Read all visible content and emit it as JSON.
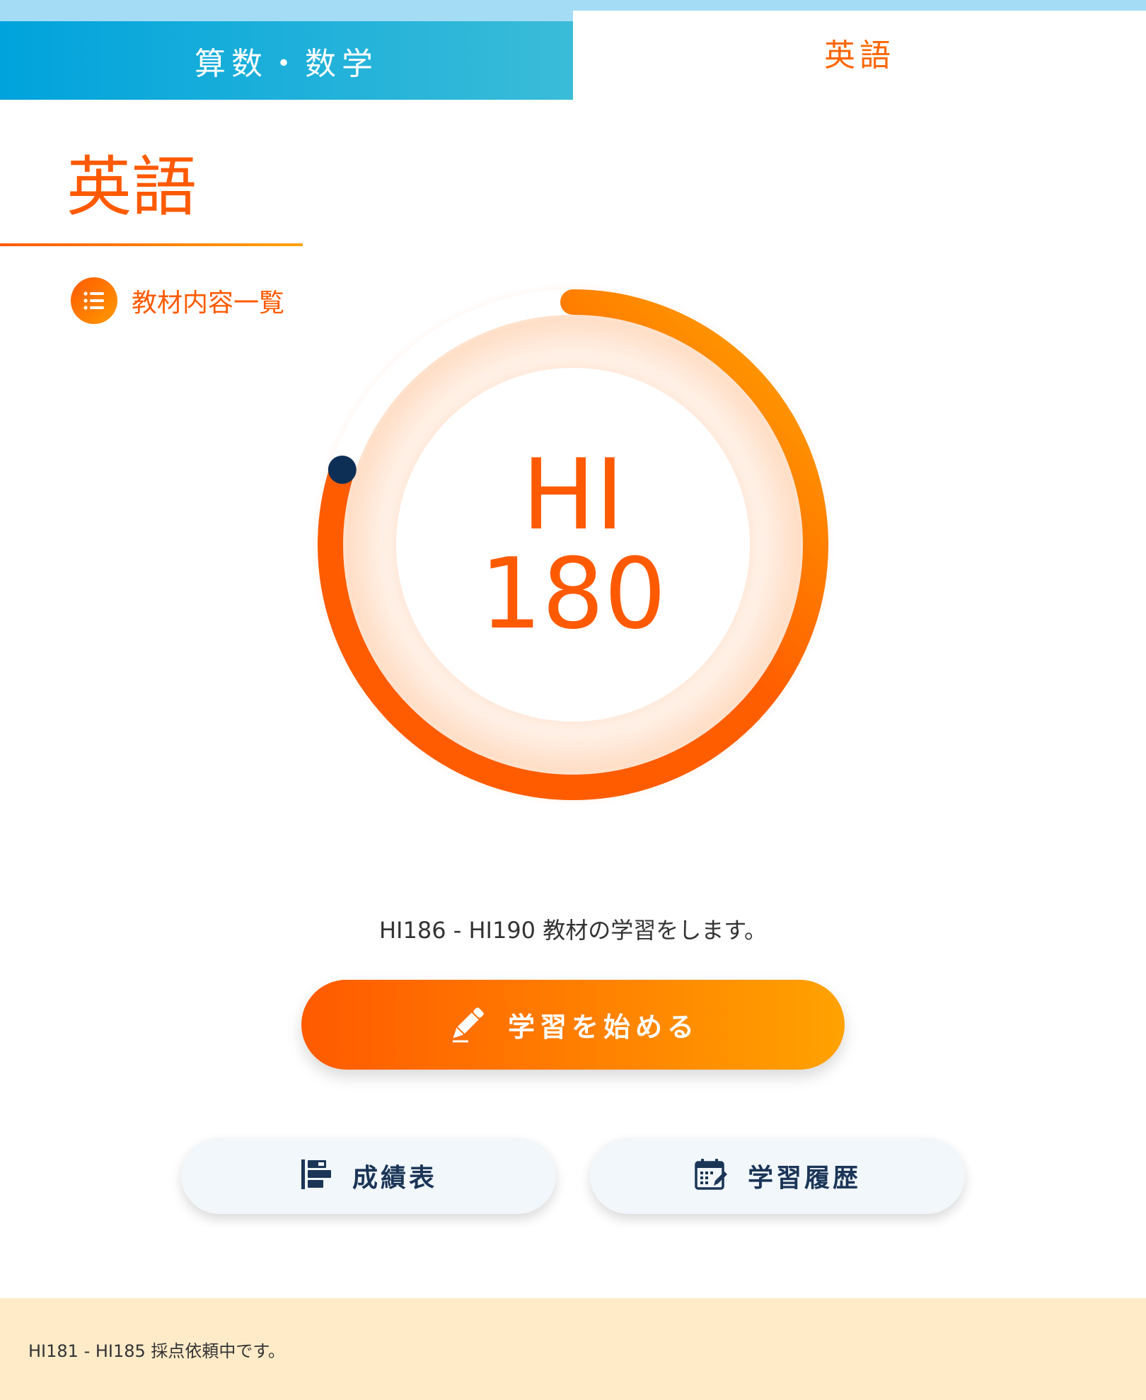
{
  "tabs": [
    {
      "label": "算数・数学",
      "active": false
    },
    {
      "label": "英語",
      "active": true
    }
  ],
  "page": {
    "title": "英語",
    "materials_link_label": "教材内容一覧"
  },
  "progress": {
    "prefix": "HI",
    "value": "180",
    "fraction": 0.8
  },
  "next_message": "HI186 - HI190 教材の学習をします。",
  "start_button": {
    "label": "学習を始める",
    "icon": "pencil-icon"
  },
  "grades_button": {
    "label": "成績表",
    "icon": "report-icon"
  },
  "history_button": {
    "label": "学習履歴",
    "icon": "calendar-icon"
  },
  "footer": {
    "message": "HI181 - HI185 採点依頼中です。"
  },
  "colors": {
    "accent_orange": "#ff5a00",
    "accent_amber": "#ffa200",
    "math_tab_blue": "#00a3dc",
    "navy": "#1b3557",
    "footer_bg": "#ffebc8"
  }
}
